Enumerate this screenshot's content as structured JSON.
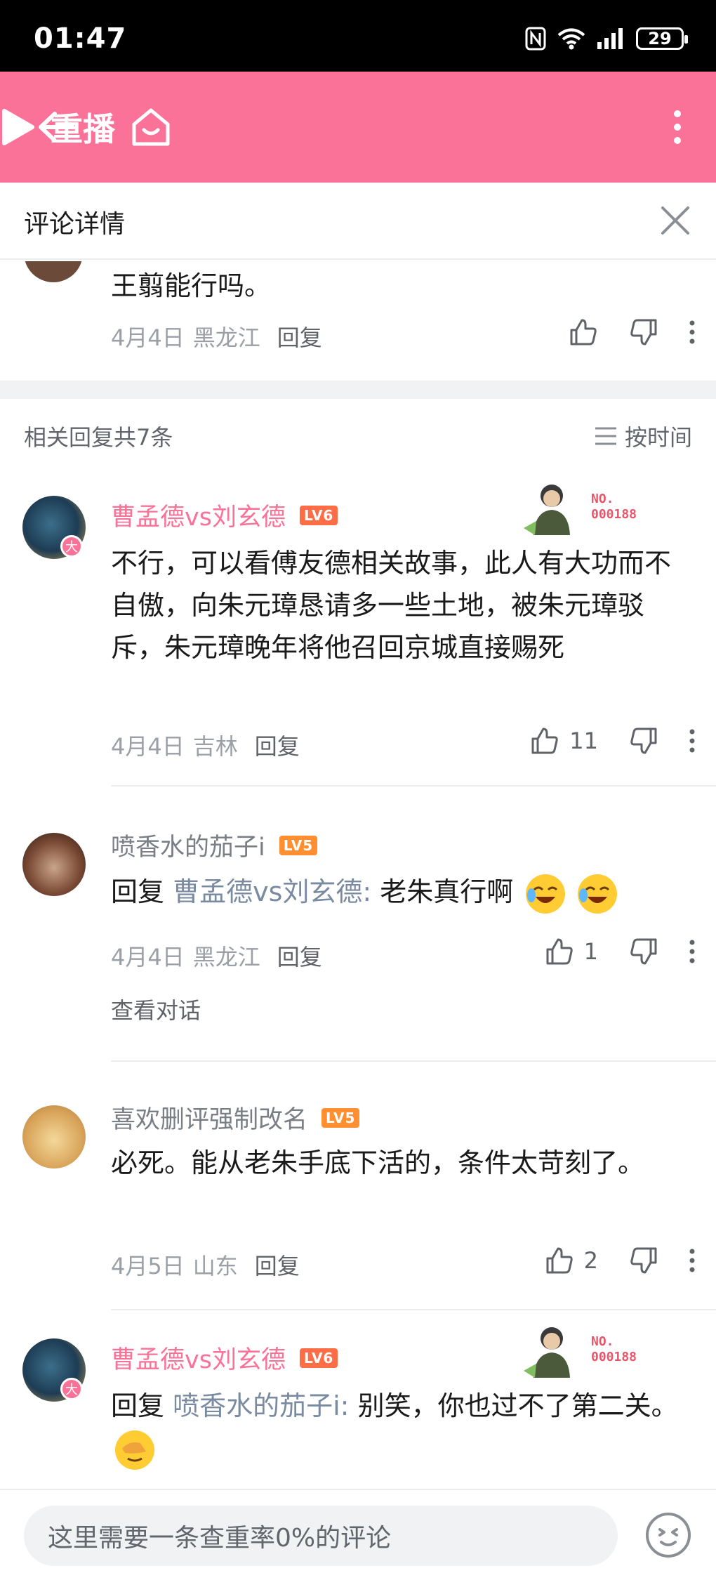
{
  "status_bar": {
    "time": "01:47",
    "battery": "29"
  },
  "toolbar": {
    "replay_label": "重播"
  },
  "panel": {
    "title": "评论详情"
  },
  "root_comment": {
    "text": "王翦能行吗。",
    "date": "4月4日",
    "location": "黑龙江",
    "reply_label": "回复"
  },
  "related": {
    "label": "相关回复共7条",
    "sort_label": "按时间"
  },
  "replies": [
    {
      "username": "曹孟德vs刘玄德",
      "level": "LV6",
      "fan_badge": "NO.\n000188",
      "text": "不行，可以看傅友德相关故事，此人有大功而不自傲，向朱元璋恳请多一些土地，被朱元璋驳斥，朱元璋晚年将他召回京城直接赐死",
      "date": "4月4日",
      "location": "吉林",
      "reply_label": "回复",
      "likes": "11"
    },
    {
      "username": "喷香水的茄子i",
      "level": "LV5",
      "prefix": "回复",
      "at": "曹孟德vs刘玄德:",
      "text": " 老朱真行啊",
      "date": "4月4日",
      "location": "黑龙江",
      "reply_label": "回复",
      "likes": "1",
      "view_dialog": "查看对话"
    },
    {
      "username": "喜欢删评强制改名",
      "level": "LV5",
      "text": "必死。能从老朱手底下活的，条件太苛刻了。",
      "date": "4月5日",
      "location": "山东",
      "reply_label": "回复",
      "likes": "2"
    },
    {
      "username": "曹孟德vs刘玄德",
      "level": "LV6",
      "fan_badge": "NO.\n000188",
      "prefix": "回复",
      "at": "喷香水的茄子i:",
      "text": " 别笑，你也过不了第二关。"
    }
  ],
  "avatar_badge": "大",
  "input": {
    "placeholder": "这里需要一条查重率0%的评论"
  },
  "colors": {
    "brand_pink": "#fb7299",
    "level6": "#ff6d46",
    "level5": "#ff8f30"
  }
}
